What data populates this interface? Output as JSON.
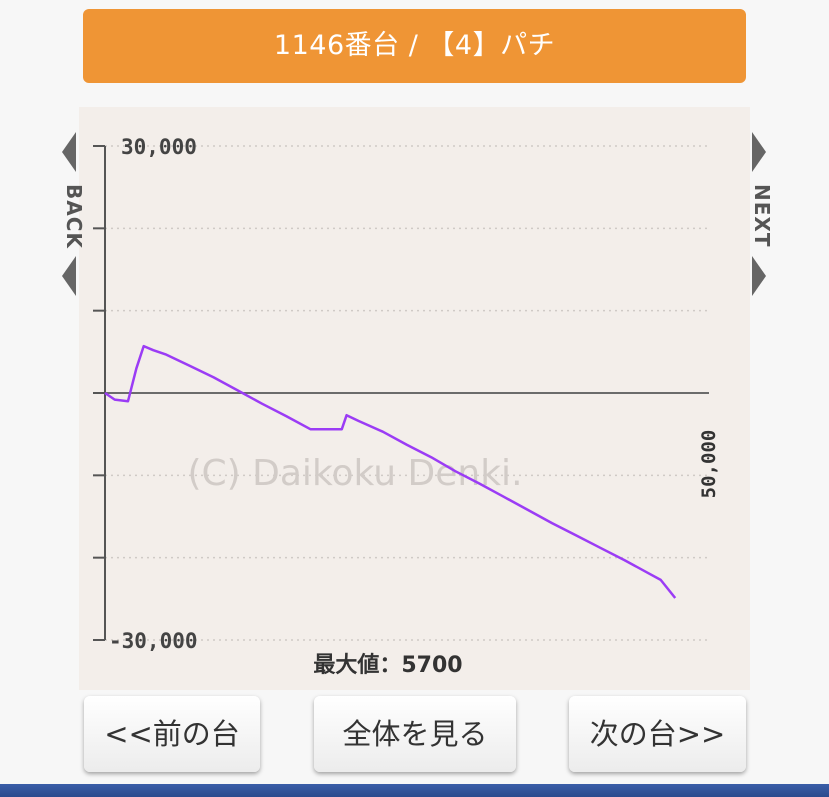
{
  "header": {
    "title": "1146番台 / 【4】パチ",
    "background_color": "#ef9535"
  },
  "nav": {
    "back_label": "BACK",
    "next_label": "NEXT"
  },
  "chart_data": {
    "type": "line",
    "ylim": [
      -30000,
      30000
    ],
    "xlim": [
      0,
      50000
    ],
    "y_tick_labels": [
      "30,000",
      "-30,000"
    ],
    "x_tick_labels": [
      "50,000"
    ],
    "grid": true,
    "watermark": "(C) Daikoku Denki.",
    "annotation": "最大値：5700",
    "line_color": "#9b3cf5",
    "series": [
      {
        "x": [
          0,
          800,
          1900,
          2600,
          3200,
          4000,
          5000,
          7000,
          9000,
          11000,
          13000,
          15000,
          17000,
          19600,
          20000,
          21000,
          23000,
          25000,
          27000,
          29000,
          31000,
          33000,
          35000,
          37000,
          39000,
          41000,
          43000,
          45000,
          46000,
          47200
        ],
        "y": [
          0,
          -800,
          -1000,
          3000,
          5700,
          5200,
          4700,
          3300,
          1900,
          300,
          -1300,
          -2800,
          -4400,
          -4400,
          -2700,
          -3400,
          -4700,
          -6300,
          -7800,
          -9500,
          -11000,
          -12600,
          -14200,
          -15800,
          -17300,
          -18800,
          -20300,
          -21900,
          -22700,
          -24900
        ]
      }
    ]
  },
  "buttons": {
    "prev": "<<前の台",
    "all": "全体を見る",
    "next": "次の台>>"
  }
}
